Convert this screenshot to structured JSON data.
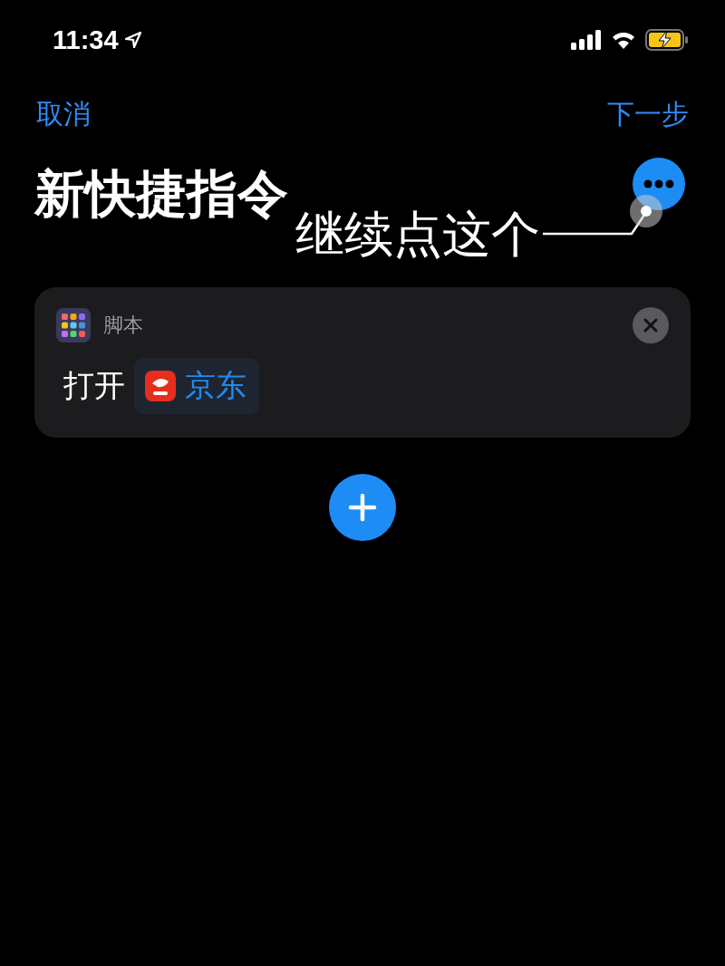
{
  "status_bar": {
    "time": "11:34"
  },
  "nav": {
    "cancel": "取消",
    "next": "下一步"
  },
  "title": "新快捷指令",
  "annotation": "继续点这个",
  "action": {
    "category": "脚本",
    "verb": "打开",
    "app": "京东"
  }
}
